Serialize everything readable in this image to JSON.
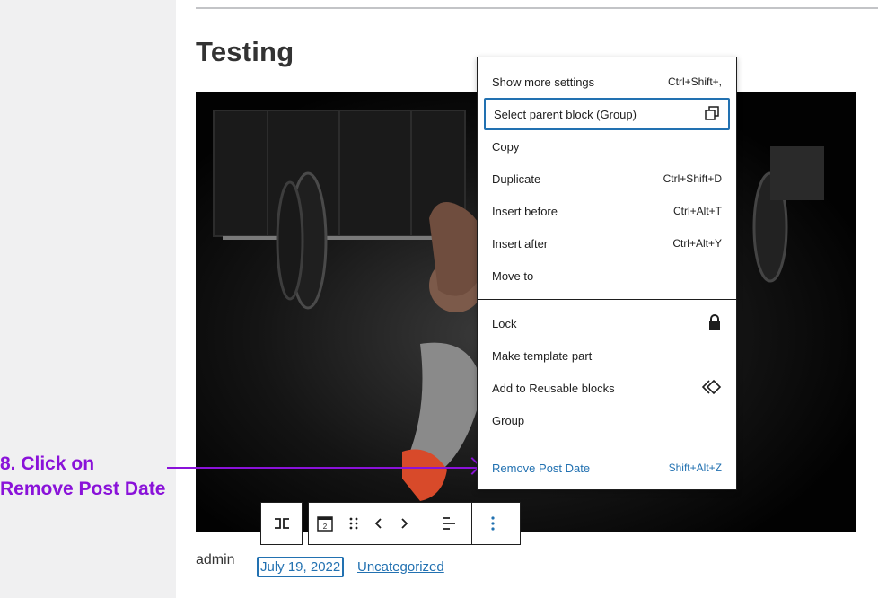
{
  "post": {
    "title": "Testing",
    "author": "admin",
    "date": "July 19, 2022",
    "category": "Uncategorized"
  },
  "annotation": {
    "line1": "8. Click on",
    "line2": "Remove Post Date"
  },
  "menu": {
    "items": [
      {
        "label": "Show more settings",
        "shortcut": "Ctrl+Shift+,"
      },
      {
        "label": "Select parent block (Group)",
        "icon": "parent-block-icon"
      },
      {
        "label": "Copy"
      },
      {
        "label": "Duplicate",
        "shortcut": "Ctrl+Shift+D"
      },
      {
        "label": "Insert before",
        "shortcut": "Ctrl+Alt+T"
      },
      {
        "label": "Insert after",
        "shortcut": "Ctrl+Alt+Y"
      },
      {
        "label": "Move to"
      },
      {
        "label": "Lock",
        "icon": "lock-icon"
      },
      {
        "label": "Make template part"
      },
      {
        "label": "Add to Reusable blocks",
        "icon": "reusable-block-icon"
      },
      {
        "label": "Group"
      },
      {
        "label": "Remove Post Date",
        "shortcut": "Shift+Alt+Z"
      }
    ]
  },
  "toolbar": {
    "post_date_icon_number": "2"
  },
  "colors": {
    "accent": "#2271b1",
    "annotation": "#8a12d9"
  }
}
